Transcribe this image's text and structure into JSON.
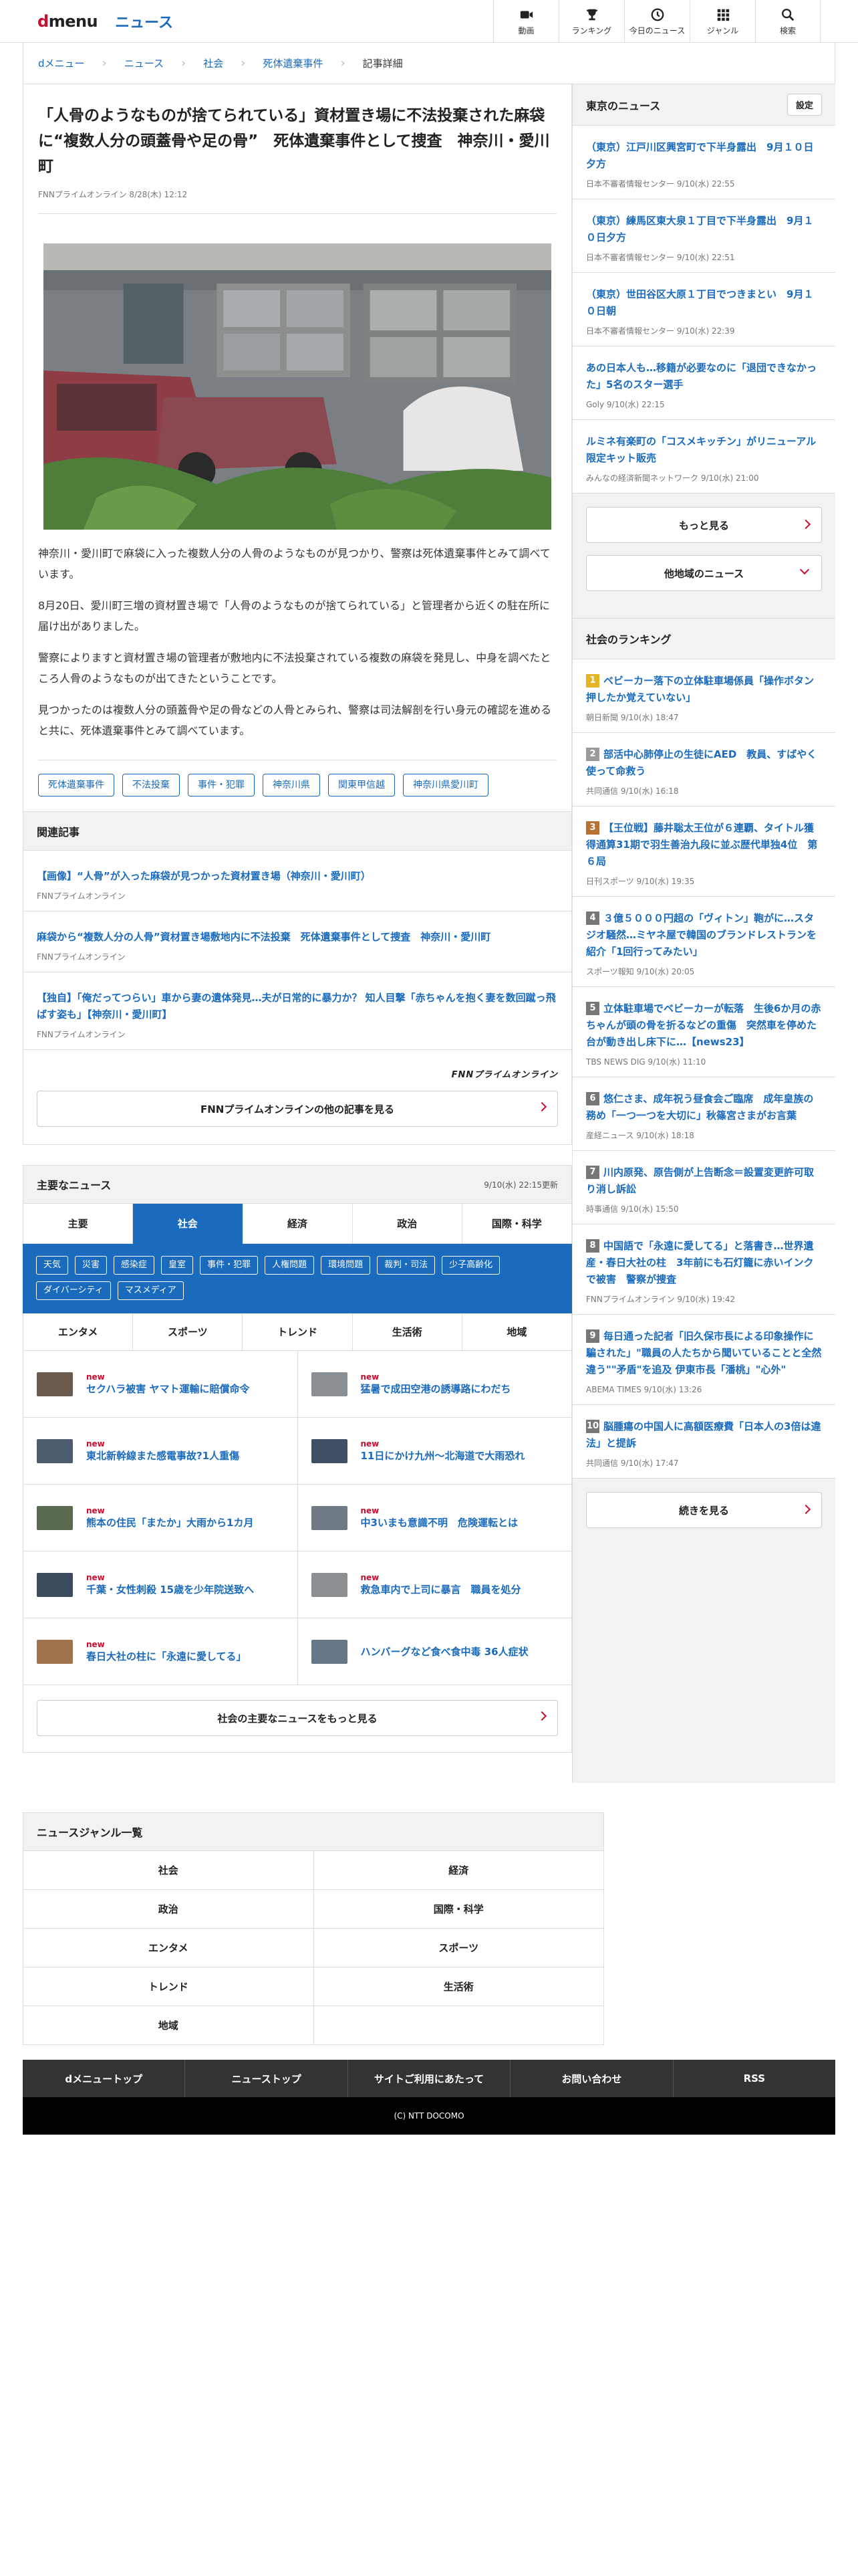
{
  "header": {
    "logo_d": "d",
    "logo_menu": "menu",
    "site_title": "ニュース",
    "nav": [
      {
        "label": "動画",
        "icon": "video-icon"
      },
      {
        "label": "ランキング",
        "icon": "trophy-icon"
      },
      {
        "label": "今日のニュース",
        "icon": "clock-icon"
      },
      {
        "label": "ジャンル",
        "icon": "grid-icon"
      },
      {
        "label": "検索",
        "icon": "search-icon"
      }
    ]
  },
  "breadcrumb": [
    "dメニュー",
    "ニュース",
    "社会",
    "死体遺棄事件",
    "記事詳細"
  ],
  "article": {
    "title": "「人骨のようなものが捨てられている」資材置き場に不法投棄された麻袋に“複数人分の頭蓋骨や足の骨”　死体遺棄事件として捜査　神奈川・愛川町",
    "byline": "FNNプライムオンライン 8/28(木) 12:12",
    "paragraphs": [
      "神奈川・愛川町で麻袋に入った複数人分の人骨のようなものが見つかり、警察は死体遺棄事件とみて調べています。",
      "8月20日、愛川町三増の資材置き場で「人骨のようなものが捨てられている」と管理者から近くの駐在所に届け出がありました。",
      "警察によりますと資材置き場の管理者が敷地内に不法投棄されている複数の麻袋を発見し、中身を調べたところ人骨のようなものが出てきたということです。",
      "見つかったのは複数人分の頭蓋骨や足の骨などの人骨とみられ、警察は司法解剖を行い身元の確認を進めると共に、死体遺棄事件とみて調べています。"
    ],
    "tags": [
      "死体遺棄事件",
      "不法投棄",
      "事件・犯罪",
      "神奈川県",
      "関東甲信越",
      "神奈川県愛川町"
    ]
  },
  "related": {
    "heading": "関連記事",
    "items": [
      {
        "title": "【画像】“人骨”が入った麻袋が見つかった資材置き場（神奈川・愛川町）",
        "source": "FNNプライムオンライン"
      },
      {
        "title": "麻袋から“複数人分の人骨”資材置き場敷地内に不法投棄　死体遺棄事件として捜査　神奈川・愛川町",
        "source": "FNNプライムオンライン"
      },
      {
        "title": "【独自】「俺だってつらい」車から妻の遺体発見…夫が日常的に暴力か？ 知人目撃「赤ちゃんを抱く妻を数回蹴っ飛ばす姿も」【神奈川・愛川町】",
        "source": "FNNプライムオンライン"
      }
    ],
    "fnn_logo": "FNNプライムオンライン",
    "more_label": "FNNプライムオンラインの他の記事を見る"
  },
  "major": {
    "heading": "主要なニュース",
    "updated": "9/10(水) 22:15更新",
    "tabs": [
      "主要",
      "社会",
      "経済",
      "政治",
      "国際・科学"
    ],
    "active_tab": 1,
    "subtags": [
      "天気",
      "災害",
      "感染症",
      "皇室",
      "事件・犯罪",
      "人権問題",
      "環境問題",
      "裁判・司法",
      "少子高齢化",
      "ダイバーシティ",
      "マスメディア"
    ],
    "subtabs": [
      "エンタメ",
      "スポーツ",
      "トレンド",
      "生活術",
      "地域"
    ],
    "new_label": "new",
    "items": [
      {
        "title": "セクハラ被害 ヤマト運輸に賠償命令",
        "new": true,
        "thumb": "#6b5a4e"
      },
      {
        "title": "猛暑で成田空港の誘導路にわだち",
        "new": true,
        "thumb": "#8a8f94"
      },
      {
        "title": "東北新幹線また感電事故?1人重傷",
        "new": true,
        "thumb": "#4c5b6e"
      },
      {
        "title": "11日にかけ九州〜北海道で大雨恐れ",
        "new": true,
        "thumb": "#3e4f66"
      },
      {
        "title": "熊本の住民「またか」大雨から1カ月",
        "new": true,
        "thumb": "#5a6a4f"
      },
      {
        "title": "中3いまも意識不明　危険運転とは",
        "new": true,
        "thumb": "#707a84"
      },
      {
        "title": "千葉・女性刺殺 15歳を少年院送致へ",
        "new": true,
        "thumb": "#3b4a5c"
      },
      {
        "title": "救急車内で上司に暴言　職員を処分",
        "new": true,
        "thumb": "#8c8f92"
      },
      {
        "title": "春日大社の柱に「永遠に愛してる」",
        "new": true,
        "thumb": "#a0734f"
      },
      {
        "title": "ハンバーグなど食べ食中毒 36人症状",
        "new": false,
        "thumb": "#667788"
      }
    ],
    "more_label": "社会の主要なニュースをもっと見る"
  },
  "sidebar": {
    "tokyo_heading": "東京のニュース",
    "settings_label": "設定",
    "tokyo_items": [
      {
        "title": "（東京）江戸川区興宮町で下半身露出　9月１０日夕方",
        "source": "日本不審者情報センター 9/10(水) 22:55"
      },
      {
        "title": "（東京）練馬区東大泉１丁目で下半身露出　9月１０日夕方",
        "source": "日本不審者情報センター 9/10(水) 22:51"
      },
      {
        "title": "（東京）世田谷区大原１丁目でつきまとい　9月１０日朝",
        "source": "日本不審者情報センター 9/10(水) 22:39"
      },
      {
        "title": "あの日本人も…移籍が必要なのに「退団できなかった」5名のスター選手",
        "source": "Goly 9/10(水) 22:15"
      },
      {
        "title": "ルミネ有楽町の「コスメキッチン」がリニューアル　限定キット販売",
        "source": "みんなの経済新聞ネットワーク 9/10(水) 21:00"
      }
    ],
    "more_label": "もっと見る",
    "other_region_label": "他地域のニュース",
    "ranking_heading": "社会のランキング",
    "ranking": [
      {
        "num": "1",
        "title": "ベビーカー落下の立体駐車場係員「操作ボタン押したか覚えていない」",
        "source": "朝日新聞 9/10(水) 18:47",
        "color": "#e6b422"
      },
      {
        "num": "2",
        "title": "部活中心肺停止の生徒にAED　教員、すばやく使って命救う",
        "source": "共同通信 9/10(水) 16:18",
        "color": "#9a9a9a"
      },
      {
        "num": "3",
        "title": "【王位戦】藤井聡太王位が６連覇、タイトル獲得通算31期で羽生善治九段に並ぶ歴代単独4位　第６局",
        "source": "日刊スポーツ 9/10(水) 19:35",
        "color": "#b87333"
      },
      {
        "num": "4",
        "title": "３億５０００円超の「ヴィトン」鞄がに…スタジオ騒然…ミヤネ屋で韓国のブランドレストランを紹介「1回行ってみたい」",
        "source": "スポーツ報知 9/10(水) 20:05",
        "color": "#777777"
      },
      {
        "num": "5",
        "title": "立体駐車場でベビーカーが転落　生後6か月の赤ちゃんが頭の骨を折るなどの重傷　突然車を停めた台が動き出し床下に…【news23】",
        "source": "TBS NEWS DIG 9/10(水) 11:10",
        "color": "#777777"
      },
      {
        "num": "6",
        "title": "悠仁さま、成年祝う昼食会ご臨席　成年皇族の務め「一つ一つを大切に」秋篠宮さまがお言葉",
        "source": "産経ニュース 9/10(水) 18:18",
        "color": "#777777"
      },
      {
        "num": "7",
        "title": "川内原発、原告側が上告断念＝設置変更許可取り消し訴訟",
        "source": "時事通信 9/10(水) 15:50",
        "color": "#777777"
      },
      {
        "num": "8",
        "title": "中国語で「永遠に愛してる」と落書き…世界遺産・春日大社の柱　3年前にも石灯籠に赤いインクで被害　警察が捜査",
        "source": "FNNプライムオンライン 9/10(水) 19:42",
        "color": "#777777"
      },
      {
        "num": "9",
        "title": "毎日通った記者「旧久保市長による印象操作に騙された」\"職員の人たちから聞いていることと全然違う\"\"矛盾\"を追及 伊東市長「潘桃」\"心外\"",
        "source": "ABEMA TIMES 9/10(水) 13:26",
        "color": "#777777"
      },
      {
        "num": "10",
        "title": "脳腫瘍の中国人に高額医療費「日本人の3倍は違法」と提訴",
        "source": "共同通信 9/10(水) 17:47",
        "color": "#777777"
      }
    ],
    "ranking_more_label": "続きを見る"
  },
  "genre": {
    "heading": "ニュースジャンル一覧",
    "items": [
      "社会",
      "経済",
      "政治",
      "国際・科学",
      "エンタメ",
      "スポーツ",
      "トレンド",
      "生活術",
      "地域",
      ""
    ]
  },
  "footer": {
    "nav": [
      "dメニュートップ",
      "ニューストップ",
      "サイトご利用にあたって",
      "お問い合わせ",
      "RSS"
    ],
    "copyright": "(C) NTT DOCOMO"
  }
}
